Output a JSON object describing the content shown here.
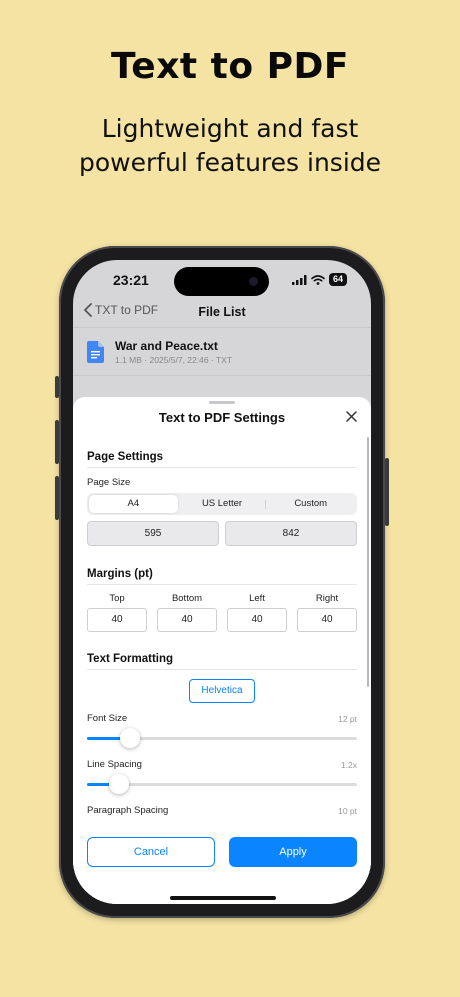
{
  "promo": {
    "title": "Text to PDF",
    "subtitle_line1": "Lightweight and fast",
    "subtitle_line2": "powerful features inside"
  },
  "status_bar": {
    "time": "23:21",
    "battery": "64"
  },
  "nav": {
    "back_label": "TXT to PDF",
    "title": "File List"
  },
  "file": {
    "name": "War and Peace.txt",
    "meta": "1.1 MB · 2025/5/7, 22:46 · TXT",
    "icon": "google-docs-file-icon"
  },
  "sheet": {
    "title": "Text to PDF Settings",
    "page_settings": {
      "heading": "Page Settings",
      "page_size_label": "Page Size",
      "options": [
        "A4",
        "US Letter",
        "Custom"
      ],
      "selected": "A4",
      "width": "595",
      "height": "842"
    },
    "margins": {
      "heading": "Margins (pt)",
      "items": [
        {
          "label": "Top",
          "value": "40"
        },
        {
          "label": "Bottom",
          "value": "40"
        },
        {
          "label": "Left",
          "value": "40"
        },
        {
          "label": "Right",
          "value": "40"
        }
      ]
    },
    "formatting": {
      "heading": "Text Formatting",
      "font": "Helvetica",
      "font_size_label": "Font Size",
      "font_size_value": "12 pt",
      "font_size_fraction": 0.16,
      "line_spacing_label": "Line Spacing",
      "line_spacing_value": "1.2x",
      "line_spacing_fraction": 0.12,
      "paragraph_spacing_label": "Paragraph Spacing",
      "paragraph_spacing_value": "10 pt"
    },
    "cancel_label": "Cancel",
    "apply_label": "Apply"
  },
  "colors": {
    "background": "#f4e3a3",
    "accent": "#0a84ff",
    "doc_icon": "#4285f4"
  }
}
